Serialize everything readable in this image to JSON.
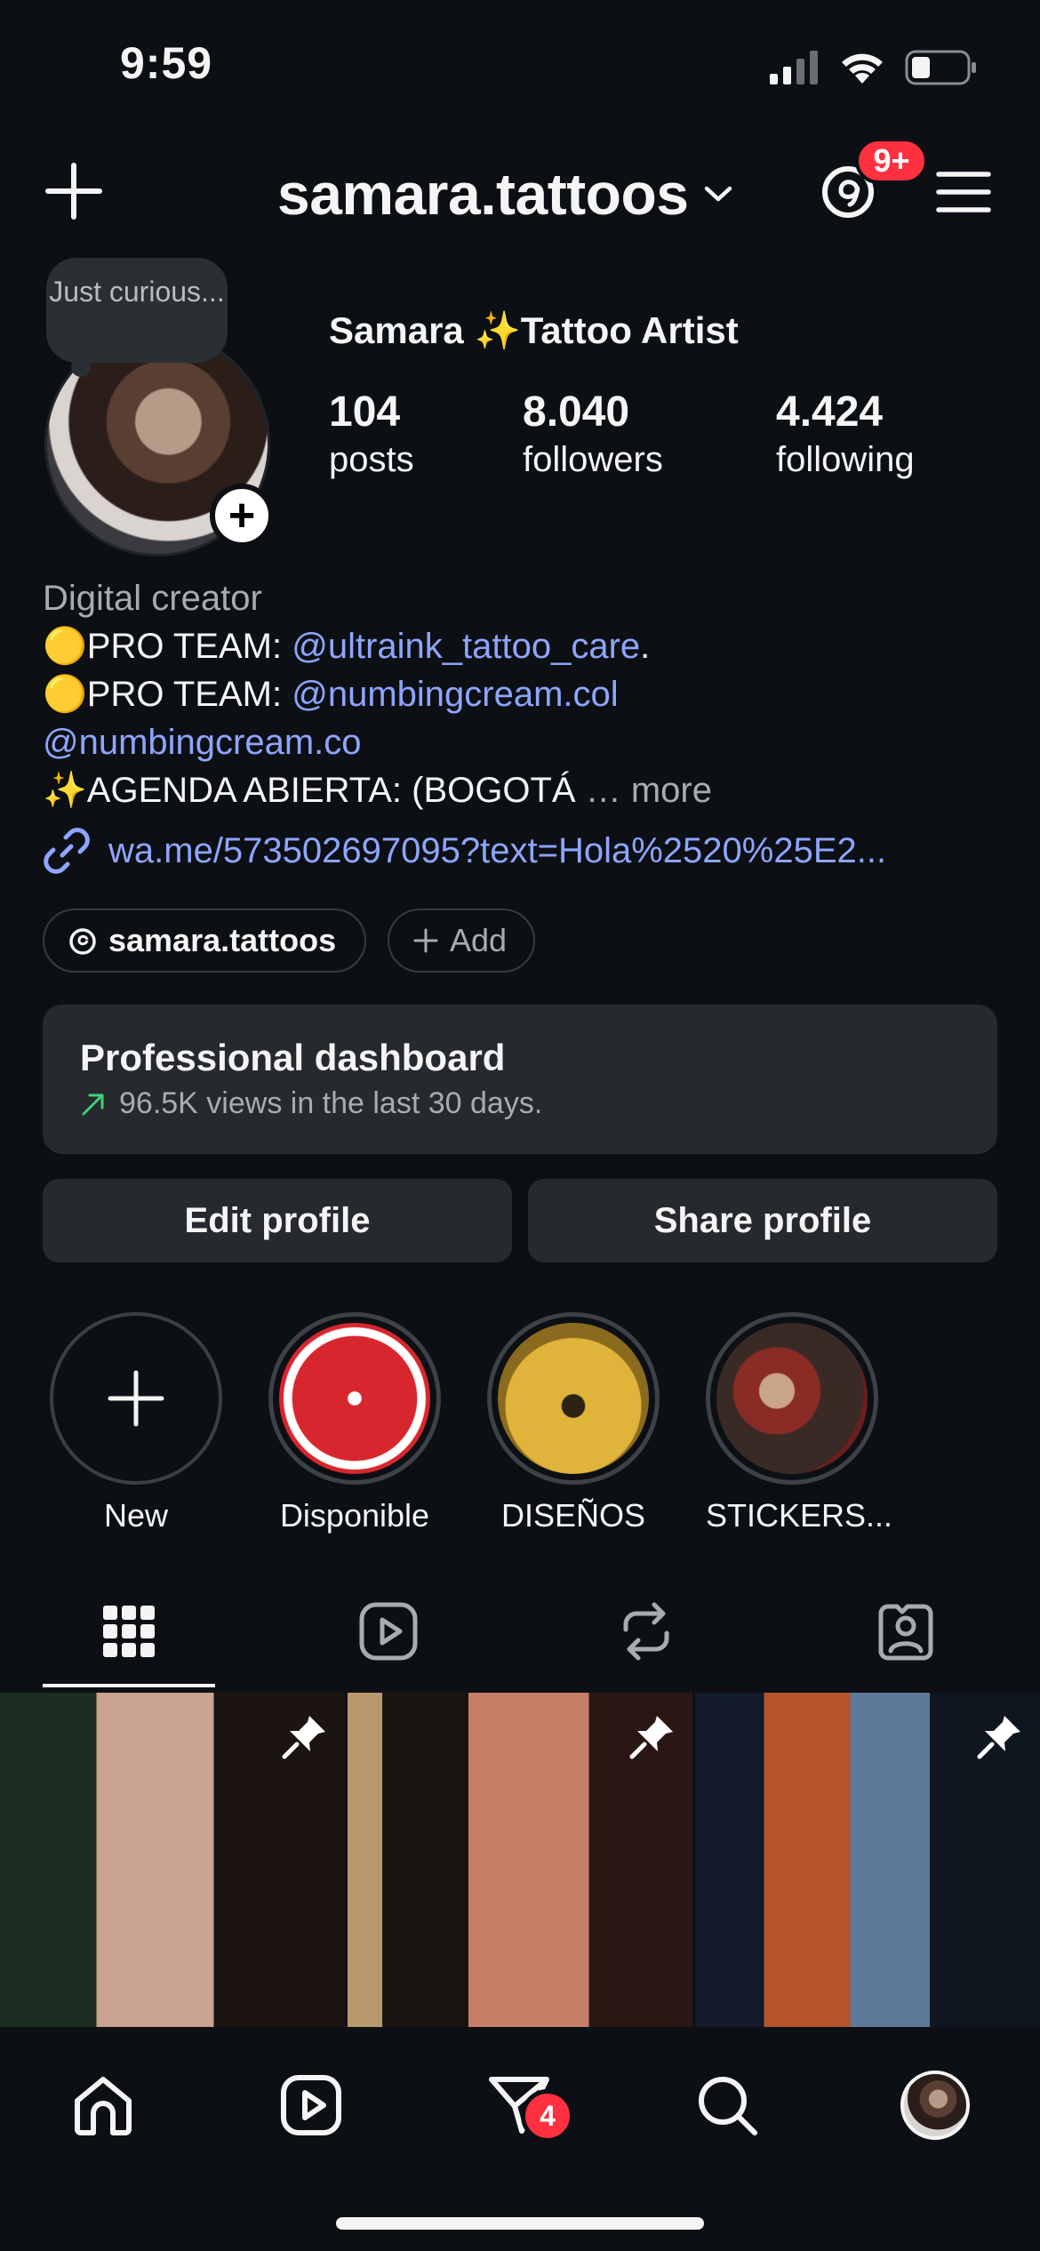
{
  "status": {
    "time": "9:59"
  },
  "header": {
    "username": "samara.tattoos",
    "notif_badge": "9+"
  },
  "profile": {
    "note": "Just curious...",
    "display_name": "Samara ✨Tattoo Artist",
    "stats": [
      {
        "value": "104",
        "label": "posts"
      },
      {
        "value": "8.040",
        "label": "followers"
      },
      {
        "value": "4.424",
        "label": "following"
      }
    ]
  },
  "bio": {
    "category": "Digital creator",
    "line1_prefix": "🟡PRO TEAM: ",
    "line1_mention": "@ultraink_tattoo_care",
    "line1_suffix": ".",
    "line2_prefix": "🟡PRO TEAM: ",
    "line2_mention": "@numbingcream.col",
    "line3_mention": "@numbingcream.co",
    "line4_text": "✨AGENDA ABIERTA: (BOGOTÁ",
    "line4_ellipsis": "…",
    "more": "more",
    "link": "wa.me/573502697095?text=Hola%2520%25E2..."
  },
  "chips": {
    "threads_handle": "samara.tattoos",
    "add_label": "Add"
  },
  "dashboard": {
    "title": "Professional dashboard",
    "subtitle": "96.5K views in the last 30 days."
  },
  "buttons": {
    "edit": "Edit profile",
    "share": "Share profile"
  },
  "highlights": [
    {
      "label": "New"
    },
    {
      "label": "Disponible"
    },
    {
      "label": "DISEÑOS"
    },
    {
      "label": "STICKERS..."
    }
  ],
  "nav": {
    "dm_badge": "4"
  },
  "colors": {
    "background": "#0c1014",
    "link": "#8ea5ff",
    "badge": "#ff3040",
    "card": "#262a2f"
  }
}
